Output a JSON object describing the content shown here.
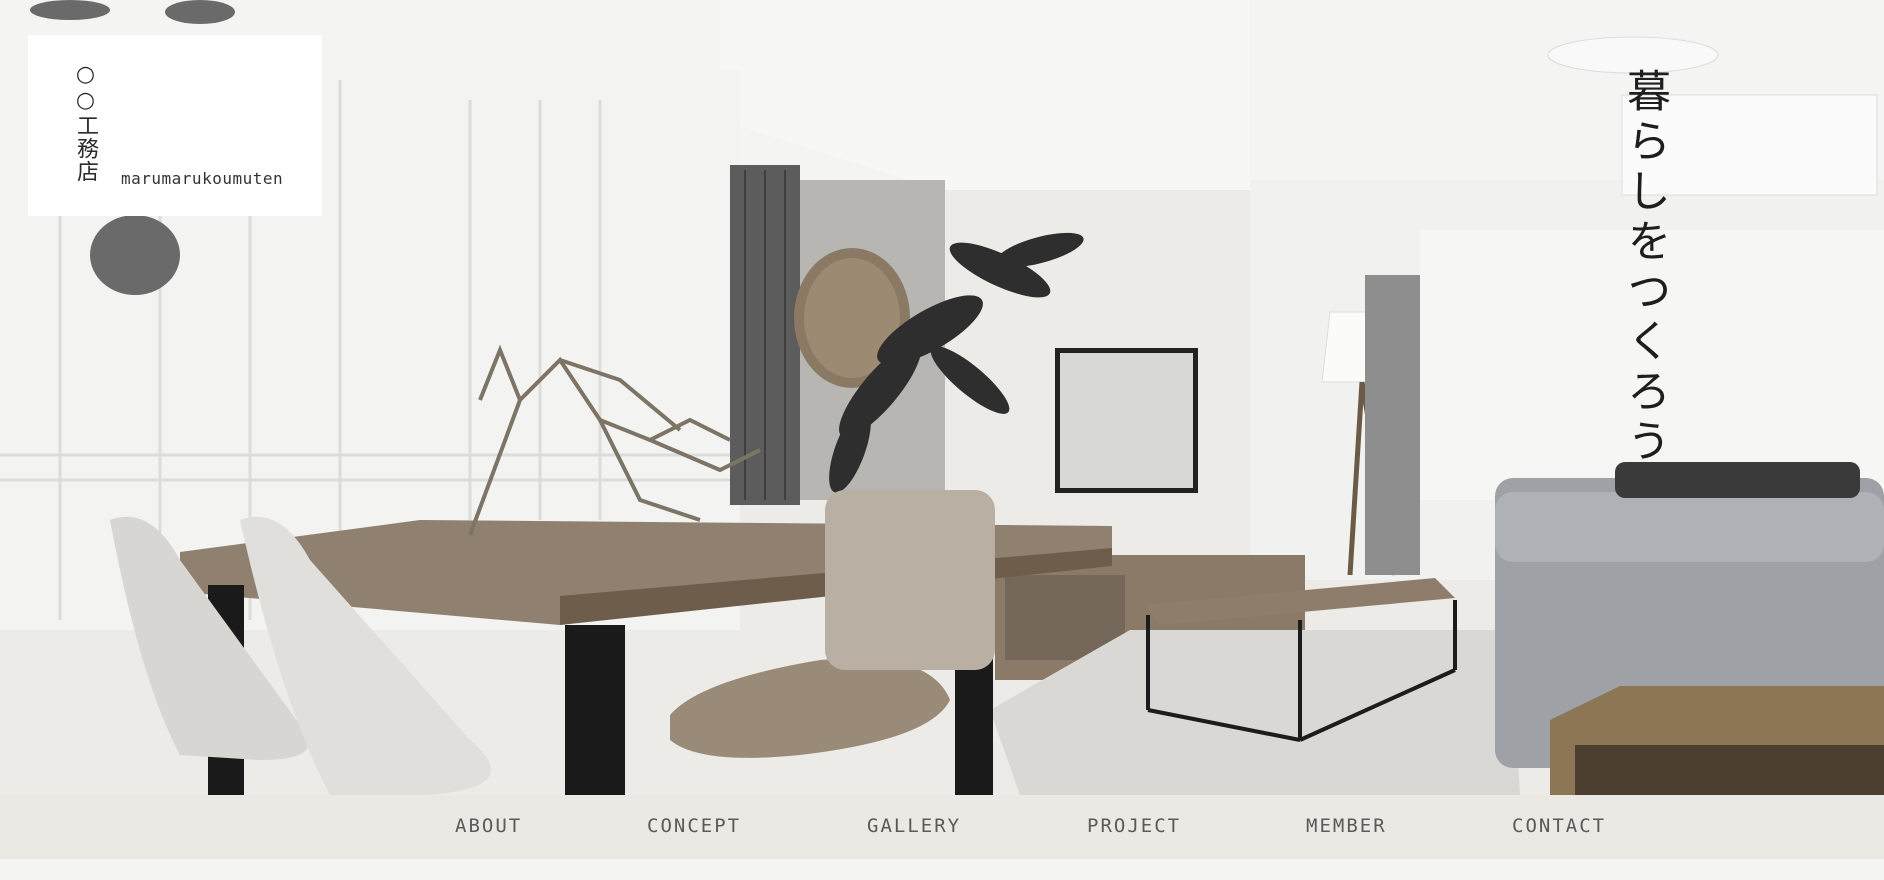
{
  "brand": {
    "name_ja": "○○工務店",
    "name_en": "marumarukoumuten"
  },
  "hero": {
    "tagline": "暮らしをつくろう"
  },
  "nav": {
    "items": [
      {
        "label": "ABOUT"
      },
      {
        "label": "CONCEPT"
      },
      {
        "label": "GALLERY"
      },
      {
        "label": "PROJECT"
      },
      {
        "label": "MEMBER"
      },
      {
        "label": "CONTACT"
      }
    ]
  },
  "colors": {
    "nav_bg": "#ebe9e3",
    "nav_text": "#5a5a5a",
    "logo_bg": "#ffffff",
    "tagline_text": "#1e1e1e"
  }
}
